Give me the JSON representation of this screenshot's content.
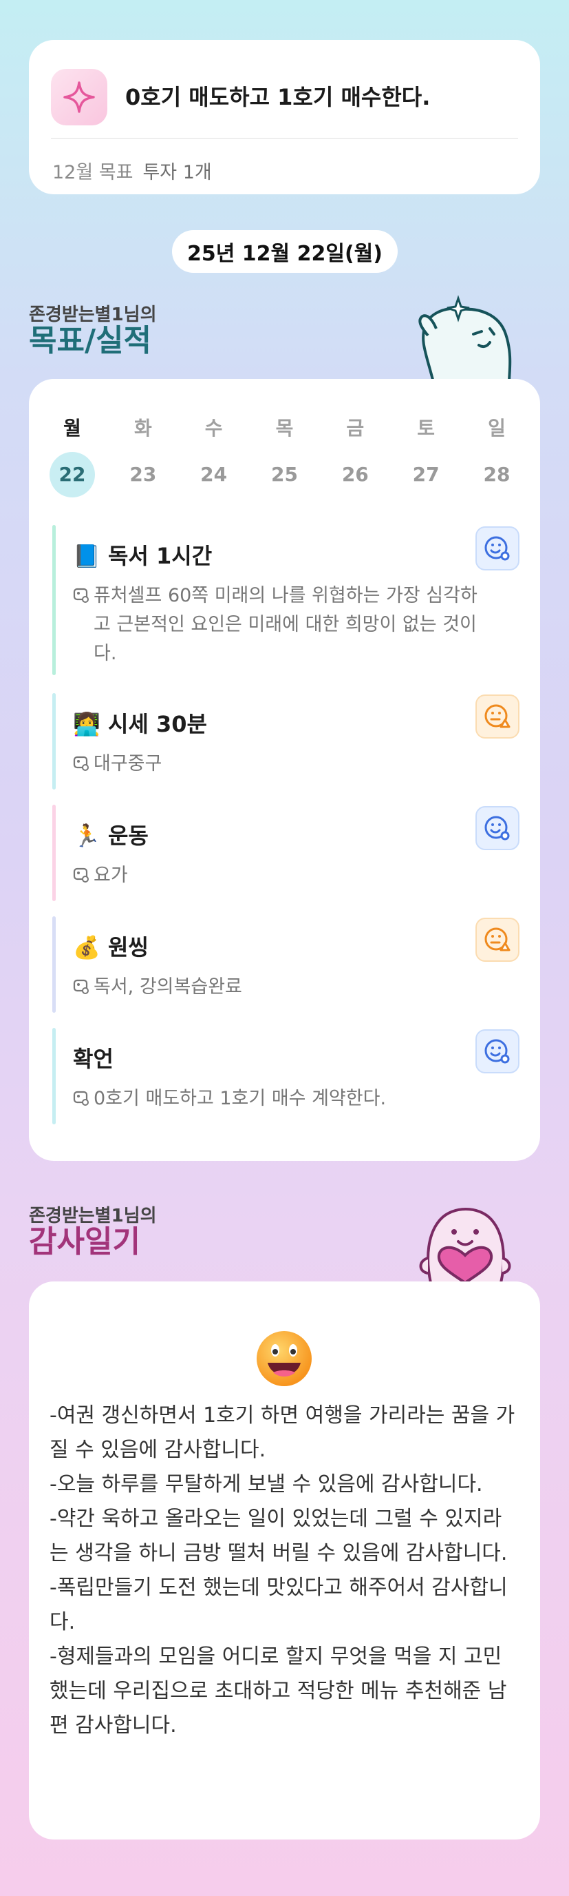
{
  "goal": {
    "title": "0호기 매도하고 1호기 매수한다.",
    "month_label": "12월 목표",
    "investment_label": "투자 1개"
  },
  "date_pill": "25년 12월 22일(월)",
  "plan_section": {
    "subtitle": "존경받는별1님의",
    "title": "목표/실적"
  },
  "week": {
    "days": [
      "월",
      "화",
      "수",
      "목",
      "금",
      "토",
      "일"
    ],
    "dates": [
      "22",
      "23",
      "24",
      "25",
      "26",
      "27",
      "28"
    ]
  },
  "tasks": [
    {
      "emoji": "📘",
      "title": "독서 1시간",
      "desc": "퓨처셀프 60쪽 미래의 나를 위협하는 가장 심각하고 근본적인 요인은 미래에 대한 희망이 없는 것이다.",
      "mood": "blue",
      "bar_color": "#b8efdc"
    },
    {
      "emoji": "👩‍💻",
      "title": "시세 30분",
      "desc": "대구중구",
      "mood": "orange",
      "bar_color": "#c6eef2"
    },
    {
      "emoji": "🏃",
      "title": "운동",
      "desc": "요가",
      "mood": "blue",
      "bar_color": "#fbd3e6"
    },
    {
      "emoji": "💰",
      "title": "원씽",
      "desc": "독서, 강의복습완료",
      "mood": "orange",
      "bar_color": "#d8def6"
    },
    {
      "emoji": "",
      "title": "확언",
      "desc": "0호기 매도하고 1호기 매수 계약한다.",
      "mood": "blue",
      "bar_color": "#c6eef2"
    }
  ],
  "thanks_section": {
    "subtitle": "존경받는별1님의",
    "title": "감사일기",
    "text": "-여권 갱신하면서 1호기 하면 여행을 가리라는 꿈을 가질 수 있음에 감사합니다.\n-오늘 하루를 무탈하게 보낼 수 있음에 감사합니다.\n-약간 욱하고 올라오는 일이 있었는데 그럴 수 있지라는 생각을 하니 금방 떨처 버릴 수 있음에 감사합니다.\n-폭립만들기 도전 했는데 맛있다고 해주어서 감사합니다.\n-형제들과의 모임을 어디로 할지 무엇을 먹을 지 고민했는데 우리집으로 초대하고 적당한 메뉴 추천해준 남편 감사합니다."
  },
  "colors": {
    "plan_title": "#1f6e78",
    "thanks_title": "#a2347a"
  }
}
